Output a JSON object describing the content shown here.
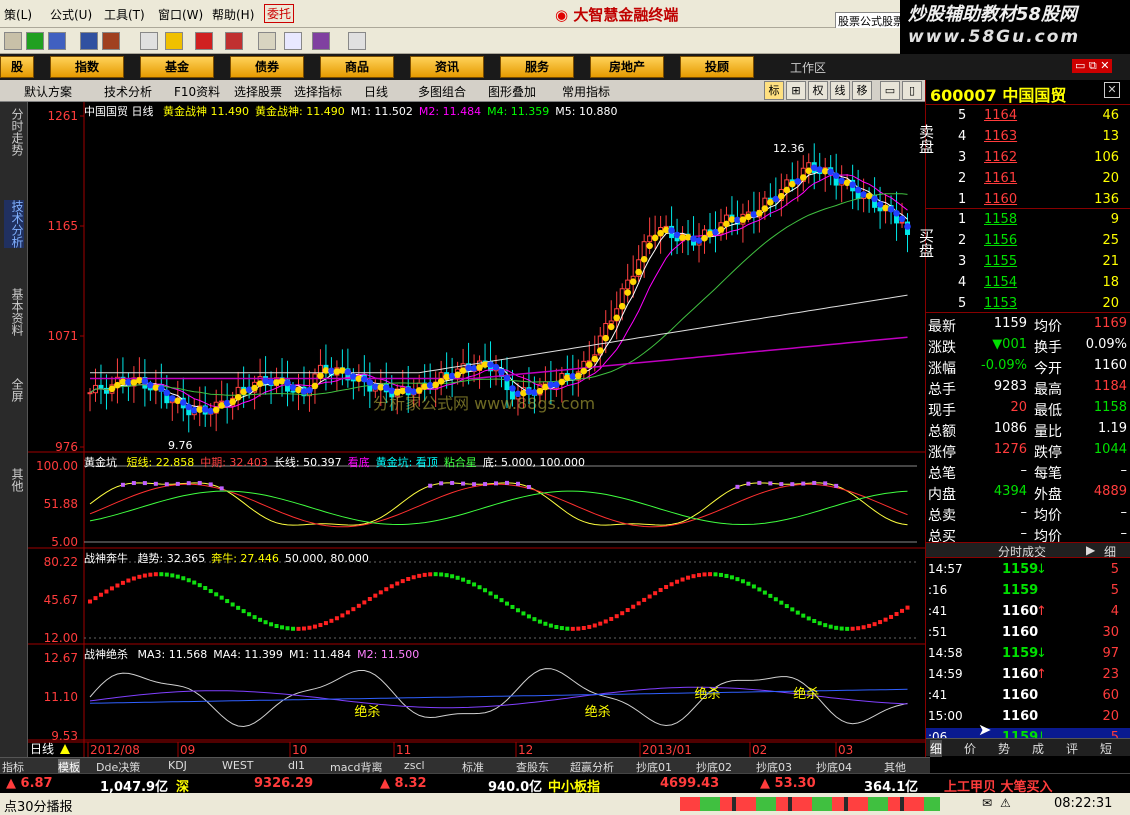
{
  "menubar": {
    "items": [
      "策(L)",
      "公式(U)",
      "工具(T)",
      "窗口(W)",
      "帮助(H)"
    ],
    "entrust": "委托",
    "brand": "大智慧金融终端",
    "formula_tab": "股票公式股票"
  },
  "watermark": {
    "line1": "炒股辅助教材58股网",
    "line2": "www.58Gu.com",
    "center": "分析家公式网 www.88gs.com"
  },
  "navbar": {
    "first": "股",
    "items": [
      "指数",
      "基金",
      "债券",
      "商品",
      "资讯",
      "服务",
      "房地产",
      "投顾"
    ],
    "workspace": "工作区"
  },
  "subbar": {
    "items": [
      "默认方案",
      "技术分析",
      "F10资料",
      "选择股票",
      "选择指标",
      "日线",
      "多图组合",
      "图形叠加",
      "常用指标"
    ],
    "right": [
      "标",
      "权",
      "线",
      "移"
    ]
  },
  "sidetabs": [
    "分时走势",
    "技术分析",
    "基本资料",
    "全屏",
    "其他"
  ],
  "main_chart": {
    "header": "中国国贸 日线",
    "indicators": [
      {
        "t": "黄金战神 11.490",
        "c": "#ffff00"
      },
      {
        "t": "黄金战神: 11.490",
        "c": "#ffff00"
      },
      {
        "t": "M1: 11.502",
        "c": "#ffffff"
      },
      {
        "t": "M2: 11.484",
        "c": "#ff00ff"
      },
      {
        "t": "M4: 11.359",
        "c": "#00ff00"
      },
      {
        "t": "M5: 10.880",
        "c": "#ffffff"
      }
    ],
    "price_axis": [
      "1261",
      "1165",
      "1071",
      "976"
    ],
    "high_label": "12.36",
    "low_label": "9.76",
    "chart_data": {
      "type": "candlestick",
      "ylim": [
        976,
        1261
      ],
      "note": "日线 K线",
      "last_close": 1159
    }
  },
  "panel1": {
    "header": "黄金坑",
    "items": [
      {
        "t": "短线: 22.858",
        "c": "#ffff00"
      },
      {
        "t": "中期: 32.403",
        "c": "#ff4040"
      },
      {
        "t": "长线: 50.397",
        "c": "#ffffff"
      },
      {
        "t": "看底",
        "c": "#ff00ff"
      },
      {
        "t": "黄金坑: 看顶",
        "c": "#00ffff"
      },
      {
        "t": "粘合星",
        "c": "#40ff40"
      },
      {
        "t": "底: 5.000, 100.000",
        "c": "#ffffff"
      }
    ],
    "axis": [
      "100.00",
      "51.88",
      "5.00"
    ]
  },
  "panel2": {
    "header": "战神奔牛",
    "items": [
      {
        "t": "趋势: 32.365",
        "c": "#ffffff"
      },
      {
        "t": "奔牛: 27.446",
        "c": "#ffff00"
      },
      {
        "t": "50.000, 80.000",
        "c": "#ffffff"
      }
    ],
    "axis": [
      "80.22",
      "45.67",
      "12.00"
    ]
  },
  "panel3": {
    "header": "战神绝杀",
    "items": [
      {
        "t": "MA3: 11.568",
        "c": "#ffffff"
      },
      {
        "t": "MA4: 11.399",
        "c": "#ffffff"
      },
      {
        "t": "M1: 11.484",
        "c": "#ffffff"
      },
      {
        "t": "M2: 11.500",
        "c": "#ff80ff"
      }
    ],
    "axis": [
      "12.67",
      "11.10",
      "9.53"
    ],
    "signals": [
      "绝杀",
      "绝杀",
      "绝杀",
      "绝杀"
    ]
  },
  "date_axis": {
    "mode": "日线",
    "labels": [
      "2012/08",
      "09",
      "10",
      "11",
      "12",
      "2013/01",
      "02",
      "03"
    ]
  },
  "quote": {
    "code": "600007",
    "name": "中国国贸",
    "asks": [
      {
        "n": "5",
        "p": "1164",
        "v": "46"
      },
      {
        "n": "4",
        "p": "1163",
        "v": "13"
      },
      {
        "n": "3",
        "p": "1162",
        "v": "106"
      },
      {
        "n": "2",
        "p": "1161",
        "v": "20"
      },
      {
        "n": "1",
        "p": "1160",
        "v": "136"
      }
    ],
    "bids": [
      {
        "n": "1",
        "p": "1158",
        "v": "9"
      },
      {
        "n": "2",
        "p": "1156",
        "v": "25"
      },
      {
        "n": "3",
        "p": "1155",
        "v": "21"
      },
      {
        "n": "4",
        "p": "1154",
        "v": "18"
      },
      {
        "n": "5",
        "p": "1153",
        "v": "20"
      }
    ],
    "sell_label": "卖盘",
    "buy_label": "买盘",
    "stats": [
      {
        "l": "最新",
        "v": "1159",
        "c": "#fff",
        "l2": "均价",
        "v2": "1169",
        "c2": "#ff3c3c"
      },
      {
        "l": "涨跌",
        "v": "▼001",
        "c": "#00e000",
        "l2": "换手",
        "v2": "0.09%",
        "c2": "#fff"
      },
      {
        "l": "涨幅",
        "v": "-0.09%",
        "c": "#00e000",
        "l2": "今开",
        "v2": "1160",
        "c2": "#fff"
      },
      {
        "l": "总手",
        "v": "9283",
        "c": "#fff",
        "l2": "最高",
        "v2": "1184",
        "c2": "#ff3c3c"
      },
      {
        "l": "现手",
        "v": "20",
        "c": "#ff3c3c",
        "l2": "最低",
        "v2": "1158",
        "c2": "#00e000"
      },
      {
        "l": "总额",
        "v": "1086",
        "c": "#fff",
        "l2": "量比",
        "v2": "1.19",
        "c2": "#fff"
      },
      {
        "l": "涨停",
        "v": "1276",
        "c": "#ff3c3c",
        "l2": "跌停",
        "v2": "1044",
        "c2": "#00e000"
      },
      {
        "l": "总笔",
        "v": "–",
        "c": "#fff",
        "l2": "每笔",
        "v2": "–",
        "c2": "#fff"
      },
      {
        "l": "内盘",
        "v": "4394",
        "c": "#00e000",
        "l2": "外盘",
        "v2": "4889",
        "c2": "#ff3c3c"
      },
      {
        "l": "总卖",
        "v": "–",
        "c": "#fff",
        "l2": "均价",
        "v2": "–",
        "c2": "#fff"
      },
      {
        "l": "总买",
        "v": "–",
        "c": "#fff",
        "l2": "均价",
        "v2": "–",
        "c2": "#fff"
      }
    ],
    "ticks_title": "分时成交",
    "ticks_btn": "细",
    "ticks": [
      {
        "t": "14:57",
        "p": "1159",
        "a": "↓",
        "v": "5",
        "pc": "#00e000",
        "vc": "#ff3c3c"
      },
      {
        "t": ":16",
        "p": "1159",
        "a": "",
        "v": "5",
        "pc": "#00e000",
        "vc": "#ff3c3c"
      },
      {
        "t": ":41",
        "p": "1160",
        "a": "↑",
        "v": "4",
        "pc": "#fff",
        "vc": "#ff3c3c"
      },
      {
        "t": ":51",
        "p": "1160",
        "a": "",
        "v": "30",
        "pc": "#fff",
        "vc": "#ff3c3c"
      },
      {
        "t": "14:58",
        "p": "1159",
        "a": "↓",
        "v": "97",
        "pc": "#00e000",
        "vc": "#ff3c3c"
      },
      {
        "t": "14:59",
        "p": "1160",
        "a": "↑",
        "v": "23",
        "pc": "#fff",
        "vc": "#ff3c3c"
      },
      {
        "t": ":41",
        "p": "1160",
        "a": "",
        "v": "60",
        "pc": "#fff",
        "vc": "#ff3c3c"
      },
      {
        "t": "15:00",
        "p": "1160",
        "a": "",
        "v": "20",
        "pc": "#fff",
        "vc": "#ff3c3c"
      },
      {
        "t": ":06",
        "p": "1159",
        "a": "↓",
        "v": "5",
        "pc": "#00e000",
        "vc": "#ff3c3c"
      }
    ],
    "bottom_tabs": [
      "细",
      "价",
      "势",
      "成",
      "评",
      "短"
    ]
  },
  "bottomtabs": [
    "指标",
    "模板",
    "Dde决策",
    "KDJ",
    "WEST",
    "dl1",
    "macd背离",
    "zscl",
    "标准",
    "查股东",
    "超赢分析",
    "抄底01",
    "抄底02",
    "抄底03",
    "抄底04",
    "其他"
  ],
  "statusbar": {
    "items": [
      {
        "t": "▲ 6.87",
        "c": "#ff3c3c"
      },
      {
        "t": "1,047.9亿",
        "c": "#fff"
      },
      {
        "t": "深",
        "c": "#ffff00"
      },
      {
        "t": "9326.29",
        "c": "#ff3c3c"
      },
      {
        "t": "▲ 8.32",
        "c": "#ff3c3c"
      },
      {
        "t": "940.0亿",
        "c": "#fff"
      },
      {
        "t": "中小板指",
        "c": "#ffff00"
      },
      {
        "t": "4699.43",
        "c": "#ff3c3c"
      },
      {
        "t": "▲ 53.30",
        "c": "#ff3c3c"
      },
      {
        "t": "364.1亿",
        "c": "#fff"
      },
      {
        "t": "上工甲贝 大笔买入",
        "c": "#ff3c3c"
      }
    ]
  },
  "statusbar2": {
    "left": "点30分播报",
    "time": "08:22:31"
  }
}
